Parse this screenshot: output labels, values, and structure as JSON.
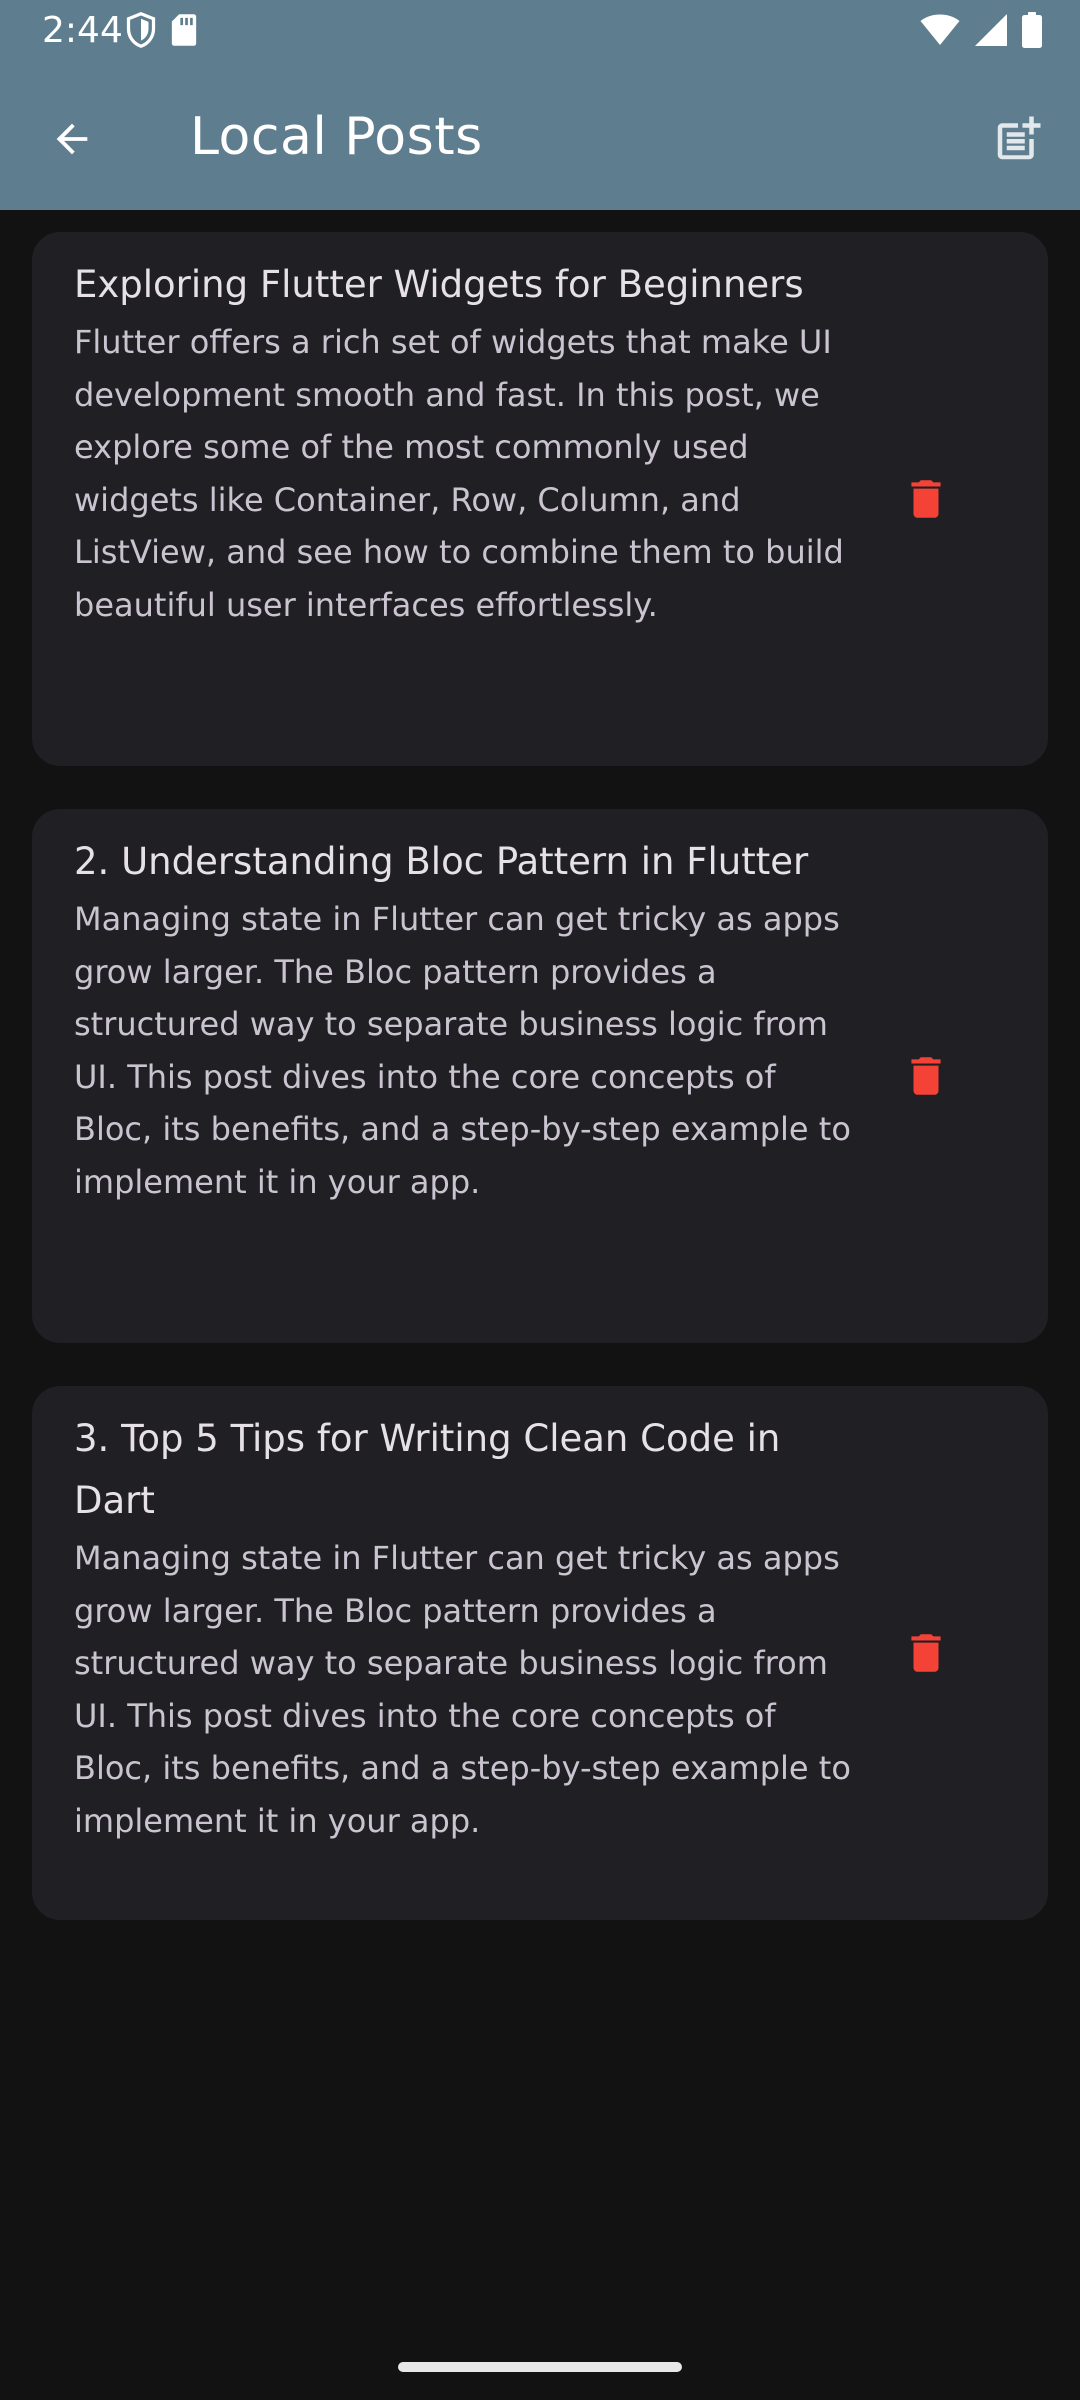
{
  "status_bar": {
    "time": "2:44",
    "left_icons": [
      "shield-icon",
      "sd-card-icon"
    ],
    "right_icons": [
      "wifi-icon",
      "cell-signal-icon",
      "battery-icon"
    ]
  },
  "app_bar": {
    "title": "Local Posts",
    "back_icon": "arrow-back-icon",
    "action_icon": "post-add-icon",
    "background_color": "#5E7D8E"
  },
  "posts": [
    {
      "title": "Exploring Flutter Widgets for Beginners",
      "body": "Flutter offers a rich set of widgets that make UI development smooth and fast. In this post, we explore some of the most commonly used widgets like Container, Row, Column, and ListView, and see how to combine them to build beautiful user interfaces effortlessly."
    },
    {
      "title": "2. Understanding Bloc Pattern in Flutter",
      "body": "Managing state in Flutter can get tricky as apps grow larger. The Bloc pattern provides a structured way to separate business logic from UI. This post dives into the core concepts of Bloc, its benefits, and a step-by-step example to implement it in your app."
    },
    {
      "title": "3. Top 5 Tips for Writing Clean Code in Dart",
      "body": "Managing state in Flutter can get tricky as apps grow larger. The Bloc pattern provides a structured way to separate business logic from UI. This post dives into the core concepts of Bloc, its benefits, and a step-by-step example to implement it in your app."
    }
  ],
  "colors": {
    "background": "#121212",
    "card": "#201F24",
    "delete_icon": "#F44336",
    "title_text": "#E6E1E5",
    "body_text": "#CAC4D0"
  }
}
